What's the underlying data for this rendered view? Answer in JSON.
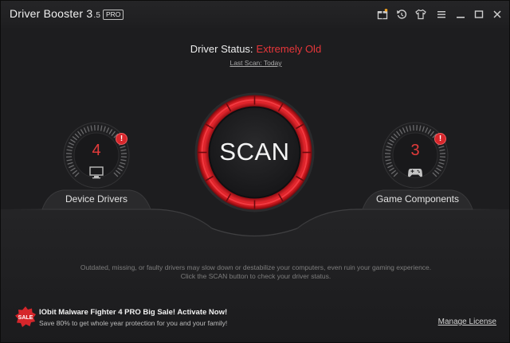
{
  "app": {
    "title": "Driver Booster 3",
    "version": ".5",
    "edition_badge": "PRO"
  },
  "titlebar_icons": [
    "gift-icon",
    "restore-icon",
    "skin-icon",
    "menu-icon",
    "minimize-icon",
    "maximize-icon",
    "close-icon"
  ],
  "status": {
    "label": "Driver Status:",
    "value": "Extremely Old",
    "last_scan": "Last Scan: Today"
  },
  "device_drivers": {
    "count": "4",
    "label": "Device Drivers",
    "alert": "!"
  },
  "game_components": {
    "count": "3",
    "label": "Game Components",
    "alert": "!"
  },
  "scan": {
    "label": "SCAN"
  },
  "info": {
    "line1": "Outdated, missing, or faulty drivers may slow down or destabilize your computers, even ruin your gaming experience.",
    "line2": "Click the SCAN button to check your driver status."
  },
  "promo": {
    "badge": "SALE",
    "title": "IObit Malware Fighter 4 PRO Big Sale! Activate Now!",
    "subtitle": "Save 80% to get whole year protection for you and your family!"
  },
  "footer": {
    "manage_license": "Manage License"
  },
  "colors": {
    "background": "#1d1d1f",
    "accent_red": "#e8363a",
    "text": "#ececec"
  }
}
